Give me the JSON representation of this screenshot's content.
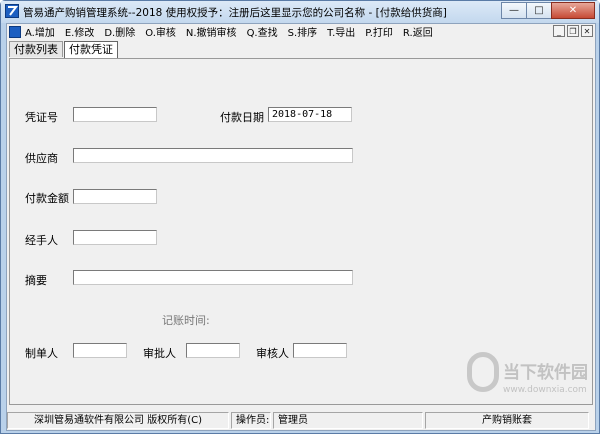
{
  "window": {
    "title": "管易通产购销管理系统--2018 使用权授予：注册后这里显示您的公司名称 - [付款给供货商]",
    "minimize_glyph": "—",
    "maximize_glyph": "□",
    "close_glyph": "✕"
  },
  "menubar": {
    "items": [
      "A.增加",
      "E.修改",
      "D.删除",
      "O.审核",
      "N.撤销审核",
      "Q.查找",
      "S.排序",
      "T.导出",
      "P.打印",
      "R.返回"
    ],
    "mdi_minimize": "_",
    "mdi_restore": "❐",
    "mdi_close": "✕"
  },
  "tabs": [
    {
      "label": "付款列表",
      "active": false
    },
    {
      "label": "付款凭证",
      "active": true
    }
  ],
  "form": {
    "voucher_no_label": "凭证号",
    "voucher_no_value": "",
    "pay_date_label": "付款日期",
    "pay_date_value": "2018-07-18",
    "supplier_label": "供应商",
    "supplier_value": "",
    "amount_label": "付款金额",
    "amount_value": "",
    "handler_label": "经手人",
    "handler_value": "",
    "summary_label": "摘要",
    "summary_value": "",
    "posting_time_label": "记账时间:",
    "maker_label": "制单人",
    "maker_value": "",
    "approver_label": "审批人",
    "approver_value": "",
    "reviewer_label": "审核人",
    "reviewer_value": ""
  },
  "status": {
    "company": "深圳管易通软件有限公司  版权所有(C)",
    "operator_label": "操作员:",
    "operator_value": "管理员",
    "product": "产购销账套"
  },
  "watermark": {
    "text": "当下软件园",
    "url": "www.downxia.com"
  }
}
